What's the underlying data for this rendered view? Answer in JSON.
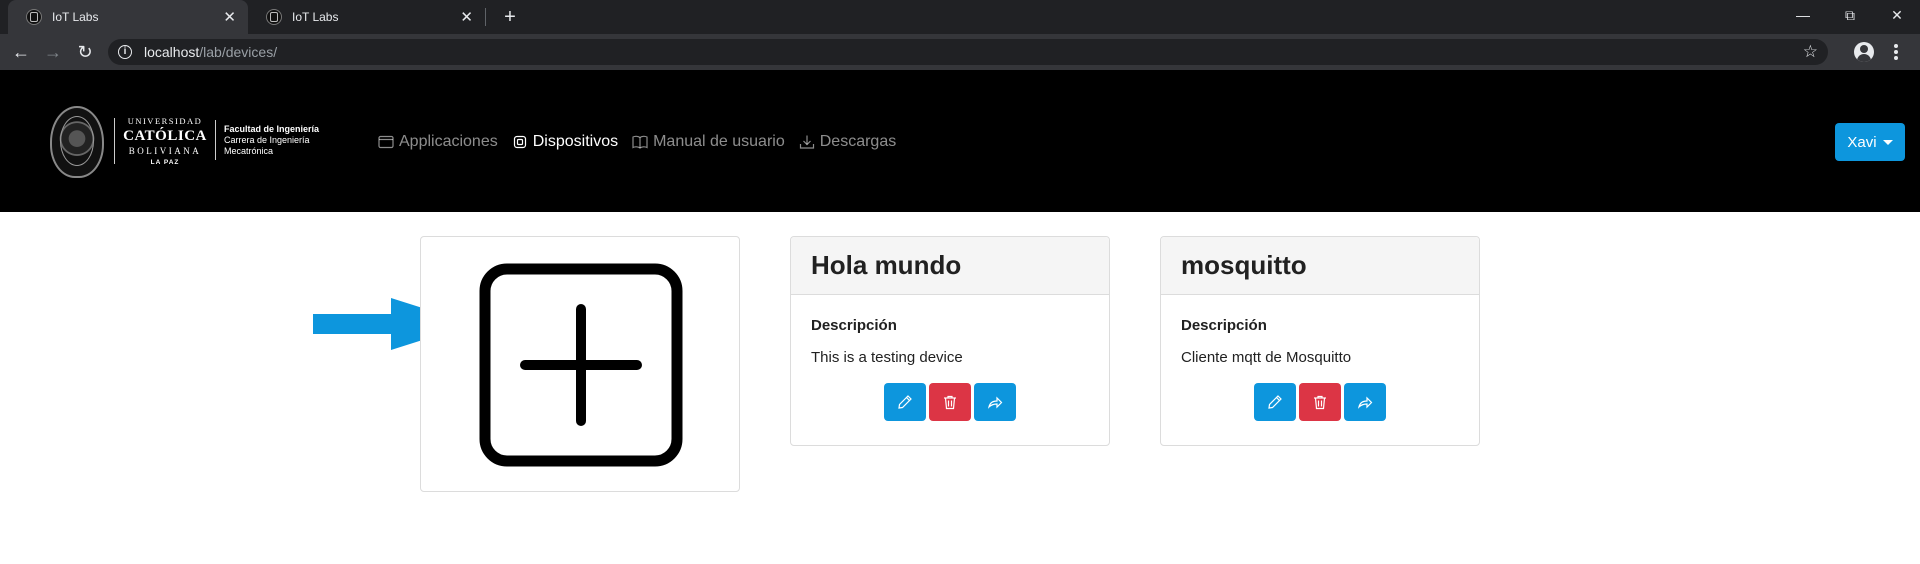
{
  "browser": {
    "tabs": [
      {
        "title": "IoT Labs",
        "active": true
      },
      {
        "title": "IoT Labs",
        "active": false
      }
    ],
    "url_host": "localhost",
    "url_path": "/lab/devices/"
  },
  "site": {
    "logo": {
      "line1": "UNIVERSIDAD",
      "line2": "CATÓLICA",
      "line3": "BOLIVIANA",
      "line4": "LA PAZ",
      "faculty": "Facultad de Ingeniería",
      "career1": "Carrera de Ingeniería",
      "career2": "Mecatrónica"
    },
    "nav": [
      {
        "label": "Applicaciones",
        "icon": "window-icon",
        "active": false
      },
      {
        "label": "Dispositivos",
        "icon": "chip-icon",
        "active": true
      },
      {
        "label": "Manual de usuario",
        "icon": "book-icon",
        "active": false
      },
      {
        "label": "Descargas",
        "icon": "download-icon",
        "active": false
      }
    ],
    "user": "Xavi"
  },
  "devices": [
    {
      "name": "Hola mundo",
      "description_label": "Descripción",
      "description": "This is a testing device"
    },
    {
      "name": "mosquitto",
      "description_label": "Descripción",
      "description": "Cliente mqtt de Mosquitto"
    }
  ],
  "colors": {
    "primary": "#0d96dd",
    "danger": "#dc3545",
    "header_bg": "#000000",
    "arrow": "#0d96dd"
  }
}
